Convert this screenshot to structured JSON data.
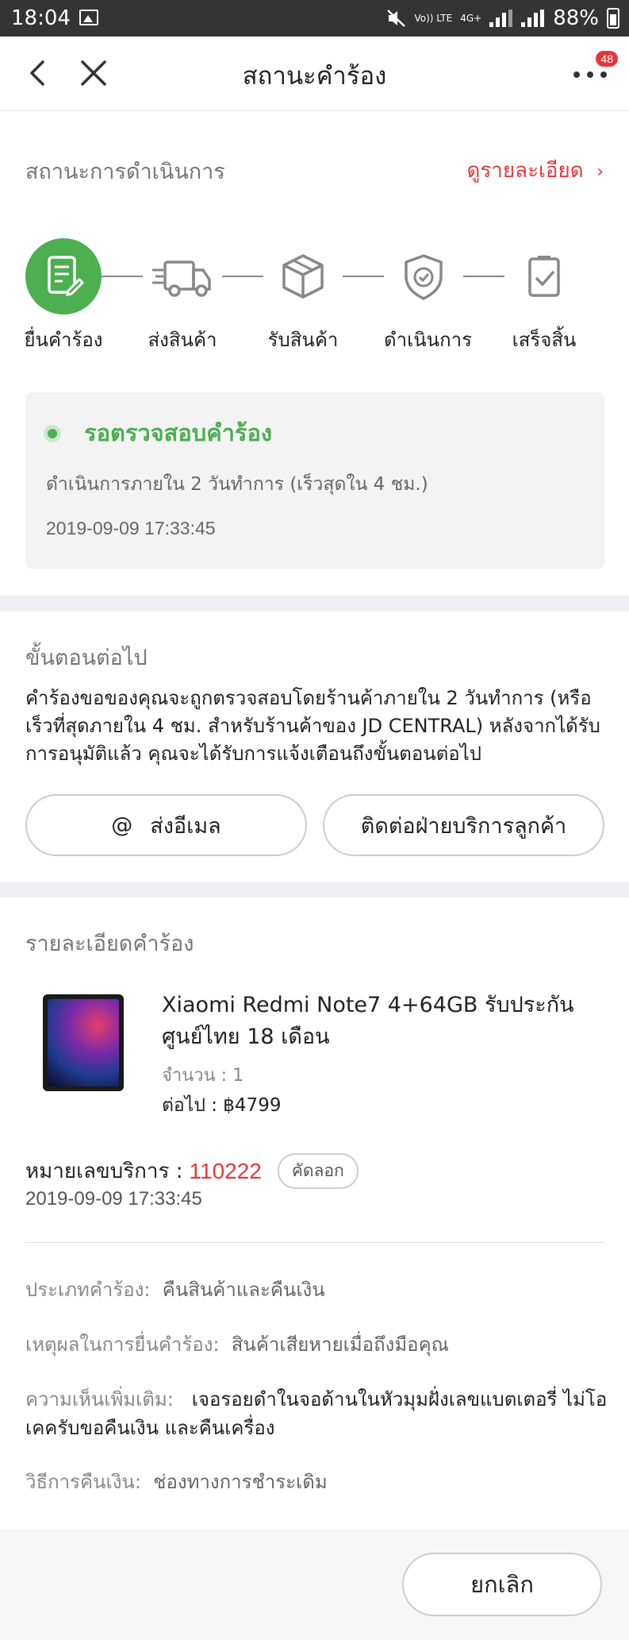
{
  "status_bar": {
    "time": "18:04",
    "volte": "Vo)) LTE",
    "net": "4G+",
    "battery": "88%"
  },
  "header": {
    "title": "สถานะคำร้อง",
    "badge": "48"
  },
  "progress": {
    "title": "สถานะการดำเนินการ",
    "detail_link": "ดูรายละเอียด",
    "steps": [
      {
        "label": "ยื่นคำร้อง",
        "icon": "document-edit-icon",
        "active": true
      },
      {
        "label": "ส่งสินค้า",
        "icon": "delivery-truck-icon",
        "active": false
      },
      {
        "label": "รับสินค้า",
        "icon": "package-box-icon",
        "active": false
      },
      {
        "label": "ดำเนินการ",
        "icon": "shield-check-icon",
        "active": false
      },
      {
        "label": "เสร็จสิ้น",
        "icon": "clipboard-check-icon",
        "active": false
      }
    ],
    "status": {
      "title": "รอตรวจสอบคำร้อง",
      "description": "ดำเนินการภายใน 2 วันทำการ (เร็วสุดใน 4 ชม.)",
      "time": "2019-09-09 17:33:45"
    },
    "accent_color": "#4caf50"
  },
  "next_step": {
    "title": "ขั้นตอนต่อไป",
    "text": "คำร้องขอของคุณจะถูกตรวจสอบโดยร้านค้าภายใน 2 วันทำการ (หรือเร็วที่สุดภายใน 4 ชม. สำหรับร้านค้าของ JD CENTRAL) หลังจากได้รับการอนุมัติแล้ว คุณจะได้รับการแจ้งเตือนถึงขั้นตอนต่อไป",
    "email_icon": "@",
    "email_button": "ส่งอีเมล",
    "contact_button": "ติดต่อฝ่ายบริการลูกค้า"
  },
  "request_details": {
    "title": "รายละเอียดคำร้อง",
    "product": {
      "name": "Xiaomi Redmi Note7 4+64GB รับประกันศูนย์ไทย 18 เดือน",
      "qty": "จำนวน : 1",
      "price": "ต่อไป : ฿4799"
    },
    "service_label": "หมายเลขบริการ :",
    "service_number": "110222",
    "copy_button": "คัดลอก",
    "service_time": "2019-09-09 17:33:45",
    "rows": [
      {
        "key": "ประเภทคำร้อง:",
        "value": "คืนสินค้าและคืนเงิน"
      },
      {
        "key": "เหตุผลในการยื่นคำร้อง:",
        "value": "สินค้าเสียหายเมื่อถึงมือคุณ"
      },
      {
        "key": "ความเห็นเพิ่มเติม:",
        "value": "เจอรอยดำในจอด้านในหัวมุมฝั่งเลขแบตเตอรี่ ไม่โอเคครับขอคืนเงิน และคืนเครื่อง"
      },
      {
        "key": "วิธีการคืนเงิน:",
        "value": "ช่องทางการชำระเดิม"
      }
    ]
  },
  "footer": {
    "cancel_button": "ยกเลิก"
  }
}
